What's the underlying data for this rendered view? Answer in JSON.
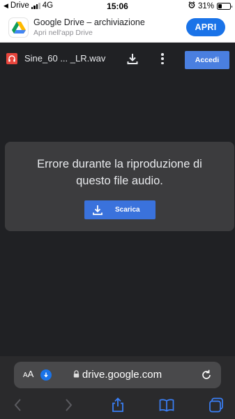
{
  "status_bar": {
    "back_app": "Drive",
    "network": "4G",
    "time": "15:06",
    "battery_text": "31%",
    "battery_level": 0.31
  },
  "app_banner": {
    "title": "Google Drive – archiviazione",
    "subtitle": "Apri nell'app Drive",
    "open_label": "APRI"
  },
  "drive_toolbar": {
    "file_name": "Sine_60 ... _LR.wav",
    "sign_in_label": "Accedi"
  },
  "viewer": {
    "error_message": "Errore durante la riproduzione di questo file audio.",
    "download_label": "Scarica"
  },
  "safari": {
    "text_size_label_big": "A",
    "text_size_label_small": "A",
    "url": "drive.google.com"
  },
  "colors": {
    "accent": "#1a73e8",
    "drive_bg": "#202124",
    "card_bg": "#3c3c3e",
    "audio_icon": "#e8453c"
  }
}
